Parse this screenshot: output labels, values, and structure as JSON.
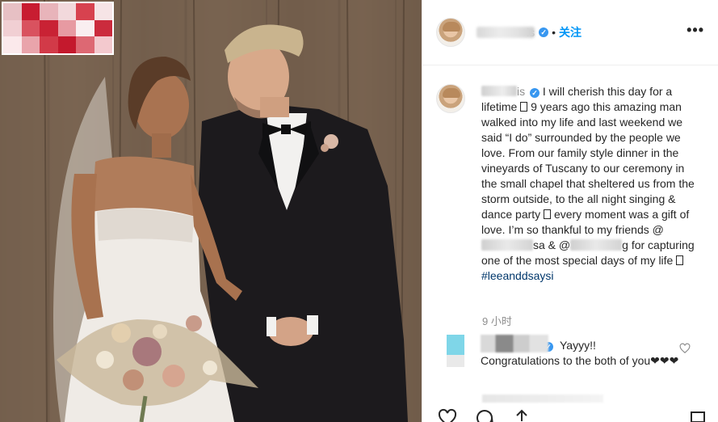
{
  "post": {
    "username_suffix": "is",
    "verified_glyph": "✓",
    "separator": "•",
    "follow_label": "关注",
    "more_label": "•••"
  },
  "caption": {
    "username_suffix": "is",
    "verified_glyph": "✓",
    "part1": " I will cherish this day for a lifetime ",
    "part2": " 9 years ago this amazing man walked into my life and last weekend we said “I do” surrounded by the people we love. From our family style dinner in the vineyards of Tuscany to our ceremony in the small chapel that sheltered us from the storm outside, to the all night singing & dance party ",
    "part3": " every moment was a gift of love. I’m so thankful to my friends @",
    "mention1_suffix": "sa",
    "part4": " & @",
    "mention2_suffix": "g",
    "part5": " for capturing one of the most special days of my life ",
    "hashtag": "#leeanddsaysi"
  },
  "timestamp": "9 小时",
  "comment": {
    "verified_glyph": "✓",
    "text1": "Yayyy!!",
    "text2": "Congratulations to the both of you❤❤❤"
  },
  "icons": [
    "more-options-icon",
    "verified-badge-icon",
    "heart-icon",
    "comment-icon",
    "share-icon",
    "bookmark-icon"
  ],
  "colors": {
    "link_blue": "#0095f6",
    "verified_blue": "#3897f0",
    "hashtag": "#00376b",
    "muted": "#8e8e8e",
    "text": "#262626"
  }
}
